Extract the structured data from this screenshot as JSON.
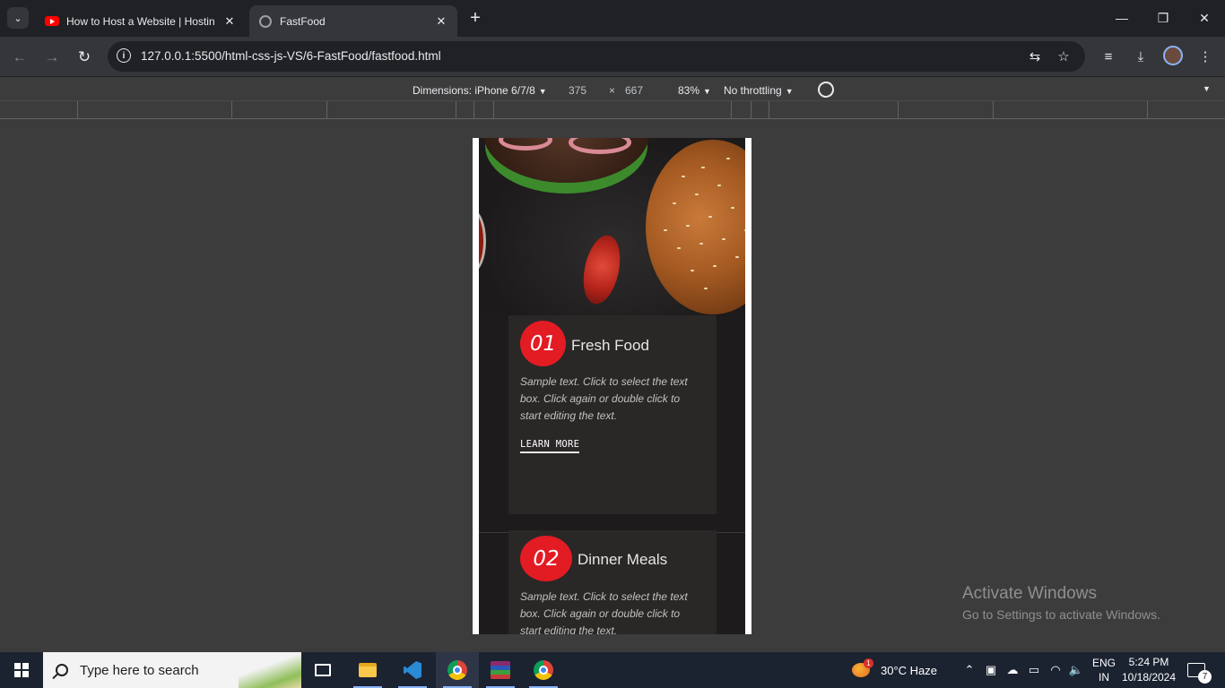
{
  "browser": {
    "tabs": [
      {
        "label": "How to Host a Website | Hostin",
        "icon": "youtube-icon"
      },
      {
        "label": "FastFood",
        "icon": "globe-icon"
      }
    ],
    "url": "127.0.0.1:5500/html-css-js-VS/6-FastFood/fastfood.html"
  },
  "devtools": {
    "dimensions_label": "Dimensions: iPhone 6/7/8",
    "width": "375",
    "times": "×",
    "height": "667",
    "zoom": "83%",
    "throttling": "No throttling"
  },
  "site": {
    "cards": [
      {
        "number": "01",
        "title": "Fresh Food",
        "text": "Sample text. Click to select the text box. Click again or double click to start editing the text.",
        "link": "LEARN MORE"
      },
      {
        "number": "02",
        "title": "Dinner Meals",
        "text": "Sample text. Click to select the text box. Click again or double click to start editing the text."
      }
    ]
  },
  "watermark": {
    "line1": "Activate Windows",
    "line2": "Go to Settings to activate Windows."
  },
  "taskbar": {
    "search_placeholder": "Type here to search",
    "weather": "30°C  Haze",
    "weather_badge": "1",
    "lang_1": "ENG",
    "lang_2": "IN",
    "time": "5:24 PM",
    "date": "10/18/2024",
    "notification_count": "7"
  }
}
